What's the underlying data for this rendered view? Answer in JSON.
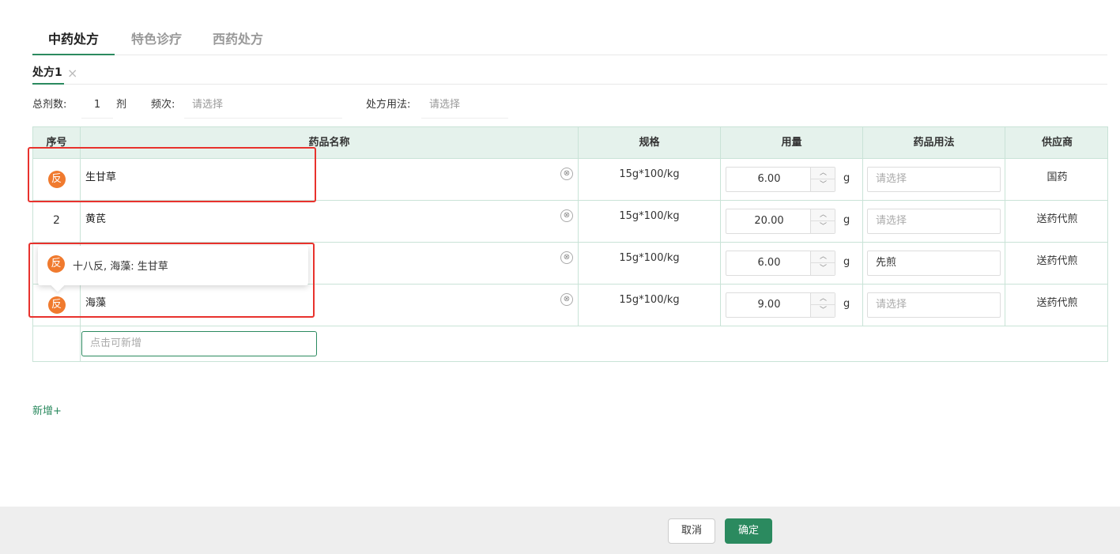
{
  "tabs": [
    {
      "label": "中药处方",
      "active": true
    },
    {
      "label": "特色诊疗",
      "active": false
    },
    {
      "label": "西药处方",
      "active": false
    }
  ],
  "subtabs": [
    {
      "label": "处方1",
      "close": "×"
    }
  ],
  "form": {
    "total_label": "总剂数:",
    "total_value": "1",
    "total_unit": "剂",
    "freq_label": "频次:",
    "freq_placeholder": "请选择",
    "usage_label": "处方用法:",
    "usage_placeholder": "请选择"
  },
  "table": {
    "headers": [
      "序号",
      "药品名称",
      "规格",
      "用量",
      "药品用法",
      "供应商"
    ],
    "rows": [
      {
        "seq": "",
        "conflict": true,
        "name": "生甘草",
        "spec": "15g*100/kg",
        "amount": "6.00",
        "unit": "g",
        "usage": "请选择",
        "usage_filled": false,
        "supplier": "国药"
      },
      {
        "seq": "2",
        "conflict": false,
        "name": "黄芪",
        "spec": "15g*100/kg",
        "amount": "20.00",
        "unit": "g",
        "usage": "请选择",
        "usage_filled": false,
        "supplier": "送药代煎"
      },
      {
        "seq": "",
        "conflict": false,
        "name": "",
        "spec": "15g*100/kg",
        "amount": "6.00",
        "unit": "g",
        "usage": "先煎",
        "usage_filled": true,
        "supplier": "送药代煎"
      },
      {
        "seq": "",
        "conflict": true,
        "name": "海藻",
        "spec": "15g*100/kg",
        "amount": "9.00",
        "unit": "g",
        "usage": "请选择",
        "usage_filled": false,
        "supplier": "送药代煎"
      }
    ],
    "add_placeholder": "点击可新增"
  },
  "conflict_badge": "反",
  "popover": {
    "badge": "反",
    "text": "十八反, 海藻:   生甘草"
  },
  "icons": {
    "clear": "⊗",
    "up": "︿",
    "down": "﹀"
  },
  "add_link": "新增+",
  "footer": {
    "cancel": "取消",
    "ok": "确定"
  },
  "colors": {
    "accent": "#2b8a5f",
    "header_bg": "#e5f2ec",
    "conflict": "#f07a2e",
    "highlight": "#e8322d",
    "footer_bg": "#eeeeee"
  }
}
